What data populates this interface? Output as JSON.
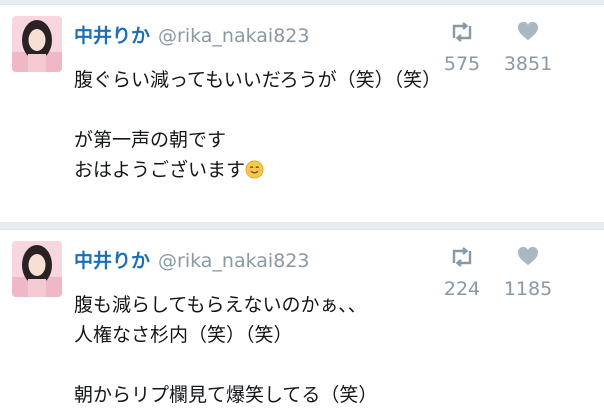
{
  "tweets": [
    {
      "name": "中井りか",
      "handle": "@rika_nakai823",
      "lines": [
        "腹ぐらい減ってもいいだろうが（笑）（笑）",
        "",
        "が第一声の朝です",
        "おはようございます"
      ],
      "emoji": "smiling-face",
      "retweets": "575",
      "likes": "3851"
    },
    {
      "name": "中井りか",
      "handle": "@rika_nakai823",
      "lines": [
        "腹も減らしてもらえないのかぁ、、",
        "人権なさ杉内（笑）（笑）",
        "",
        "朝からリプ欄見て爆笑してる（笑）"
      ],
      "retweets": "224",
      "likes": "1185"
    }
  ],
  "colors": {
    "name": "#1b6fb5",
    "muted": "#8899a6",
    "background": "#e6ecf0",
    "avatar_bg": "#f7d6df"
  },
  "icons": [
    "retweet-icon",
    "heart-icon",
    "avatar"
  ]
}
